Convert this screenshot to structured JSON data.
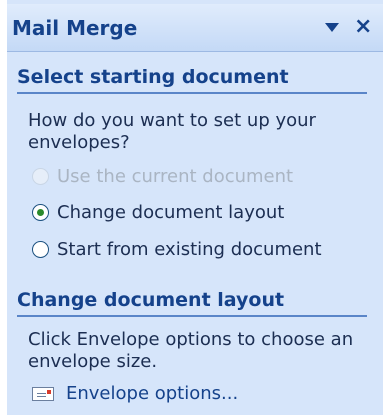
{
  "pane": {
    "title": "Mail Merge",
    "dropdown_icon": "dropdown-triangle",
    "close_label": "×"
  },
  "section1": {
    "heading": "Select starting document",
    "question": "How do you want to set up your envelopes?",
    "options": [
      {
        "label": "Use the current document",
        "state": "disabled",
        "selected": false
      },
      {
        "label": "Change document layout",
        "state": "enabled",
        "selected": true
      },
      {
        "label": "Start from existing document",
        "state": "enabled",
        "selected": false
      }
    ]
  },
  "section2": {
    "heading": "Change document layout",
    "description": "Click Envelope options to choose an envelope size.",
    "link_label": "Envelope options...",
    "link_icon": "envelope-icon"
  },
  "colors": {
    "pane_background": "#d6e5fa",
    "heading": "#15428b",
    "text": "#1c2e52",
    "selected_radio_dot": "#2b8a2b",
    "disabled_text": "#aab5c3"
  }
}
